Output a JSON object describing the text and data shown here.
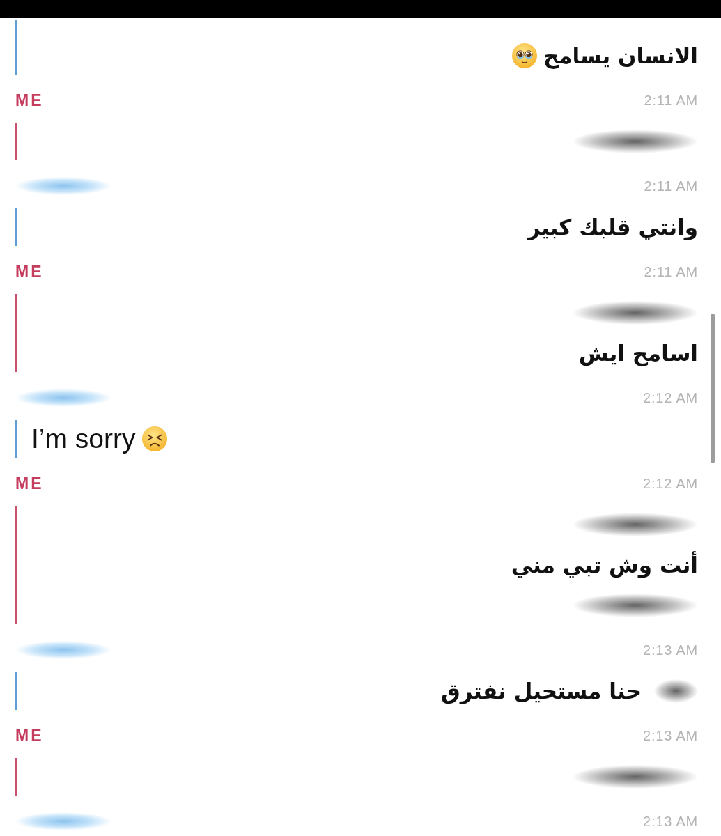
{
  "messages": [
    {
      "outgoing": false,
      "lines": [
        {
          "rtl": true,
          "parts": [
            {
              "kind": "text",
              "text": "الانسان يسامح"
            },
            {
              "kind": "pleading"
            }
          ]
        }
      ]
    },
    {
      "outgoing": true,
      "header": {
        "label": "ME",
        "time": "2:11 AM"
      },
      "lines": [
        {
          "rtl": true,
          "parts": [
            {
              "kind": "blurred"
            }
          ]
        }
      ]
    },
    {
      "outgoing": false,
      "header": {
        "time": "2:11 AM"
      },
      "lines": [
        {
          "rtl": true,
          "parts": [
            {
              "kind": "text",
              "text": "وانتي قلبك كبير"
            }
          ]
        }
      ]
    },
    {
      "outgoing": true,
      "header": {
        "label": "ME",
        "time": "2:11 AM"
      },
      "lines": [
        {
          "rtl": true,
          "parts": [
            {
              "kind": "blurred"
            }
          ]
        },
        {
          "rtl": true,
          "parts": [
            {
              "kind": "text",
              "text": "اسامح ايش"
            }
          ]
        }
      ]
    },
    {
      "outgoing": false,
      "header": {
        "time": "2:12 AM"
      },
      "lines": [
        {
          "rtl": false,
          "parts": [
            {
              "kind": "text",
              "text": "I’m sorry"
            },
            {
              "kind": "persevering"
            }
          ]
        }
      ]
    },
    {
      "outgoing": true,
      "header": {
        "label": "ME",
        "time": "2:12 AM"
      },
      "lines": [
        {
          "rtl": true,
          "parts": [
            {
              "kind": "blurred"
            }
          ]
        },
        {
          "rtl": true,
          "parts": [
            {
              "kind": "text",
              "text": "أنت وش تبي مني"
            }
          ]
        },
        {
          "rtl": true,
          "parts": [
            {
              "kind": "blurred"
            }
          ]
        }
      ]
    },
    {
      "outgoing": false,
      "header": {
        "time": "2:13 AM"
      },
      "lines": [
        {
          "rtl": true,
          "parts": [
            {
              "kind": "blurred"
            },
            {
              "kind": "text",
              "text": "حنا مستحيل نفترق"
            }
          ]
        }
      ]
    },
    {
      "outgoing": true,
      "header": {
        "label": "ME",
        "time": "2:13 AM"
      },
      "lines": [
        {
          "rtl": true,
          "parts": [
            {
              "kind": "blurred"
            }
          ]
        }
      ]
    },
    {
      "outgoing": false,
      "header": {
        "time": "2:13 AM"
      }
    }
  ]
}
